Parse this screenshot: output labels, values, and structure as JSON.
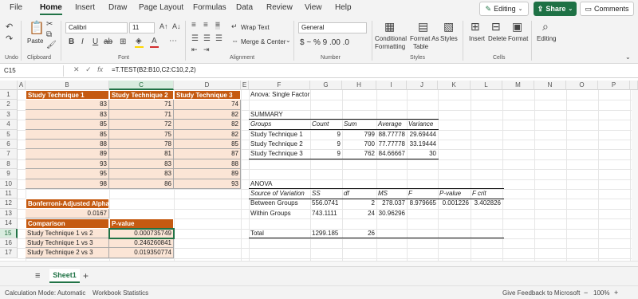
{
  "menu": {
    "items": [
      "File",
      "Home",
      "Insert",
      "Draw",
      "Page Layout",
      "Formulas",
      "Data",
      "Review",
      "View",
      "Help"
    ],
    "editing": "Editing",
    "share": "Share",
    "comments": "Comments"
  },
  "ribbon": {
    "undo": "Undo",
    "paste": "Paste",
    "clipboard": "Clipboard",
    "font_name": "Calibri",
    "font_size": "11",
    "font_group": "Font",
    "wrap_text": "Wrap Text",
    "merge_center": "Merge & Center",
    "alignment": "Alignment",
    "number_format": "General",
    "number_symbols": "$ ~ % 9 .00 .0",
    "number_group": "Number",
    "conditional_formatting_1": "Conditional",
    "conditional_formatting_2": "Formatting",
    "format_as_table_1": "Format As",
    "format_as_table_2": "Table",
    "styles": "Styles",
    "styles_group": "Styles",
    "insert": "Insert",
    "delete": "Delete",
    "format": "Format",
    "cells_group": "Cells",
    "editing_btn": "Editing",
    "accent": "#217346",
    "font_color": "#d32f2f",
    "fill_color": "#ffd700"
  },
  "formula_bar": {
    "cell_ref": "C15",
    "formula": "=T.TEST(B2:B10,C2:C10,2,2)"
  },
  "columns": [
    "A",
    "B",
    "C",
    "D",
    "E",
    "F",
    "G",
    "H",
    "I",
    "J",
    "K",
    "L",
    "M",
    "N",
    "O",
    "P"
  ],
  "rows": [
    "1",
    "2",
    "3",
    "4",
    "5",
    "6",
    "7",
    "8",
    "9",
    "10",
    "11",
    "12",
    "13",
    "14",
    "15",
    "16",
    "17"
  ],
  "selected_col": "C",
  "selected_row": "15",
  "study_table": {
    "headers": [
      "Study Technique 1",
      "Study Technique 2",
      "Study Technique 3"
    ],
    "rows": [
      [
        "83",
        "71",
        "74"
      ],
      [
        "83",
        "71",
        "82"
      ],
      [
        "85",
        "72",
        "82"
      ],
      [
        "85",
        "75",
        "82"
      ],
      [
        "88",
        "78",
        "85"
      ],
      [
        "89",
        "81",
        "87"
      ],
      [
        "93",
        "83",
        "88"
      ],
      [
        "95",
        "83",
        "89"
      ],
      [
        "98",
        "86",
        "93"
      ]
    ]
  },
  "bonferroni": {
    "label": "Bonferroni-Adjusted Alpha",
    "value": "0.0167"
  },
  "comparison_table": {
    "headers": [
      "Comparison",
      "P-value"
    ],
    "rows": [
      [
        "Study Technique 1 vs 2",
        "0.000735749"
      ],
      [
        "Study Technique 1 vs 3",
        "0.246260841"
      ],
      [
        "Study Technique 2 vs 3",
        "0.019350774"
      ]
    ]
  },
  "anova_summary": {
    "title": "Anova: Single Factor",
    "summary_label": "SUMMARY",
    "headers": [
      "Groups",
      "Count",
      "Sum",
      "Average",
      "Variance"
    ],
    "rows": [
      [
        "Study Technique 1",
        "9",
        "799",
        "88.77778",
        "29.69444"
      ],
      [
        "Study Technique 2",
        "9",
        "700",
        "77.77778",
        "33.19444"
      ],
      [
        "Study Technique 3",
        "9",
        "762",
        "84.66667",
        "30"
      ]
    ]
  },
  "anova_table": {
    "label": "ANOVA",
    "headers": [
      "Source of Variation",
      "SS",
      "df",
      "MS",
      "F",
      "P-value",
      "F crit"
    ],
    "between": [
      "Between Groups",
      "556.0741",
      "2",
      "278.037",
      "8.979665",
      "0.001226",
      "3.402826"
    ],
    "within": [
      "Within Groups",
      "743.1111",
      "24",
      "30.96296"
    ],
    "total": [
      "Total",
      "1299.185",
      "26"
    ]
  },
  "sheet_tab": "Sheet1",
  "status": {
    "calc_mode": "Calculation Mode: Automatic",
    "workbook_stats": "Workbook Statistics",
    "feedback": "Give Feedback to Microsoft",
    "zoom": "100%"
  }
}
